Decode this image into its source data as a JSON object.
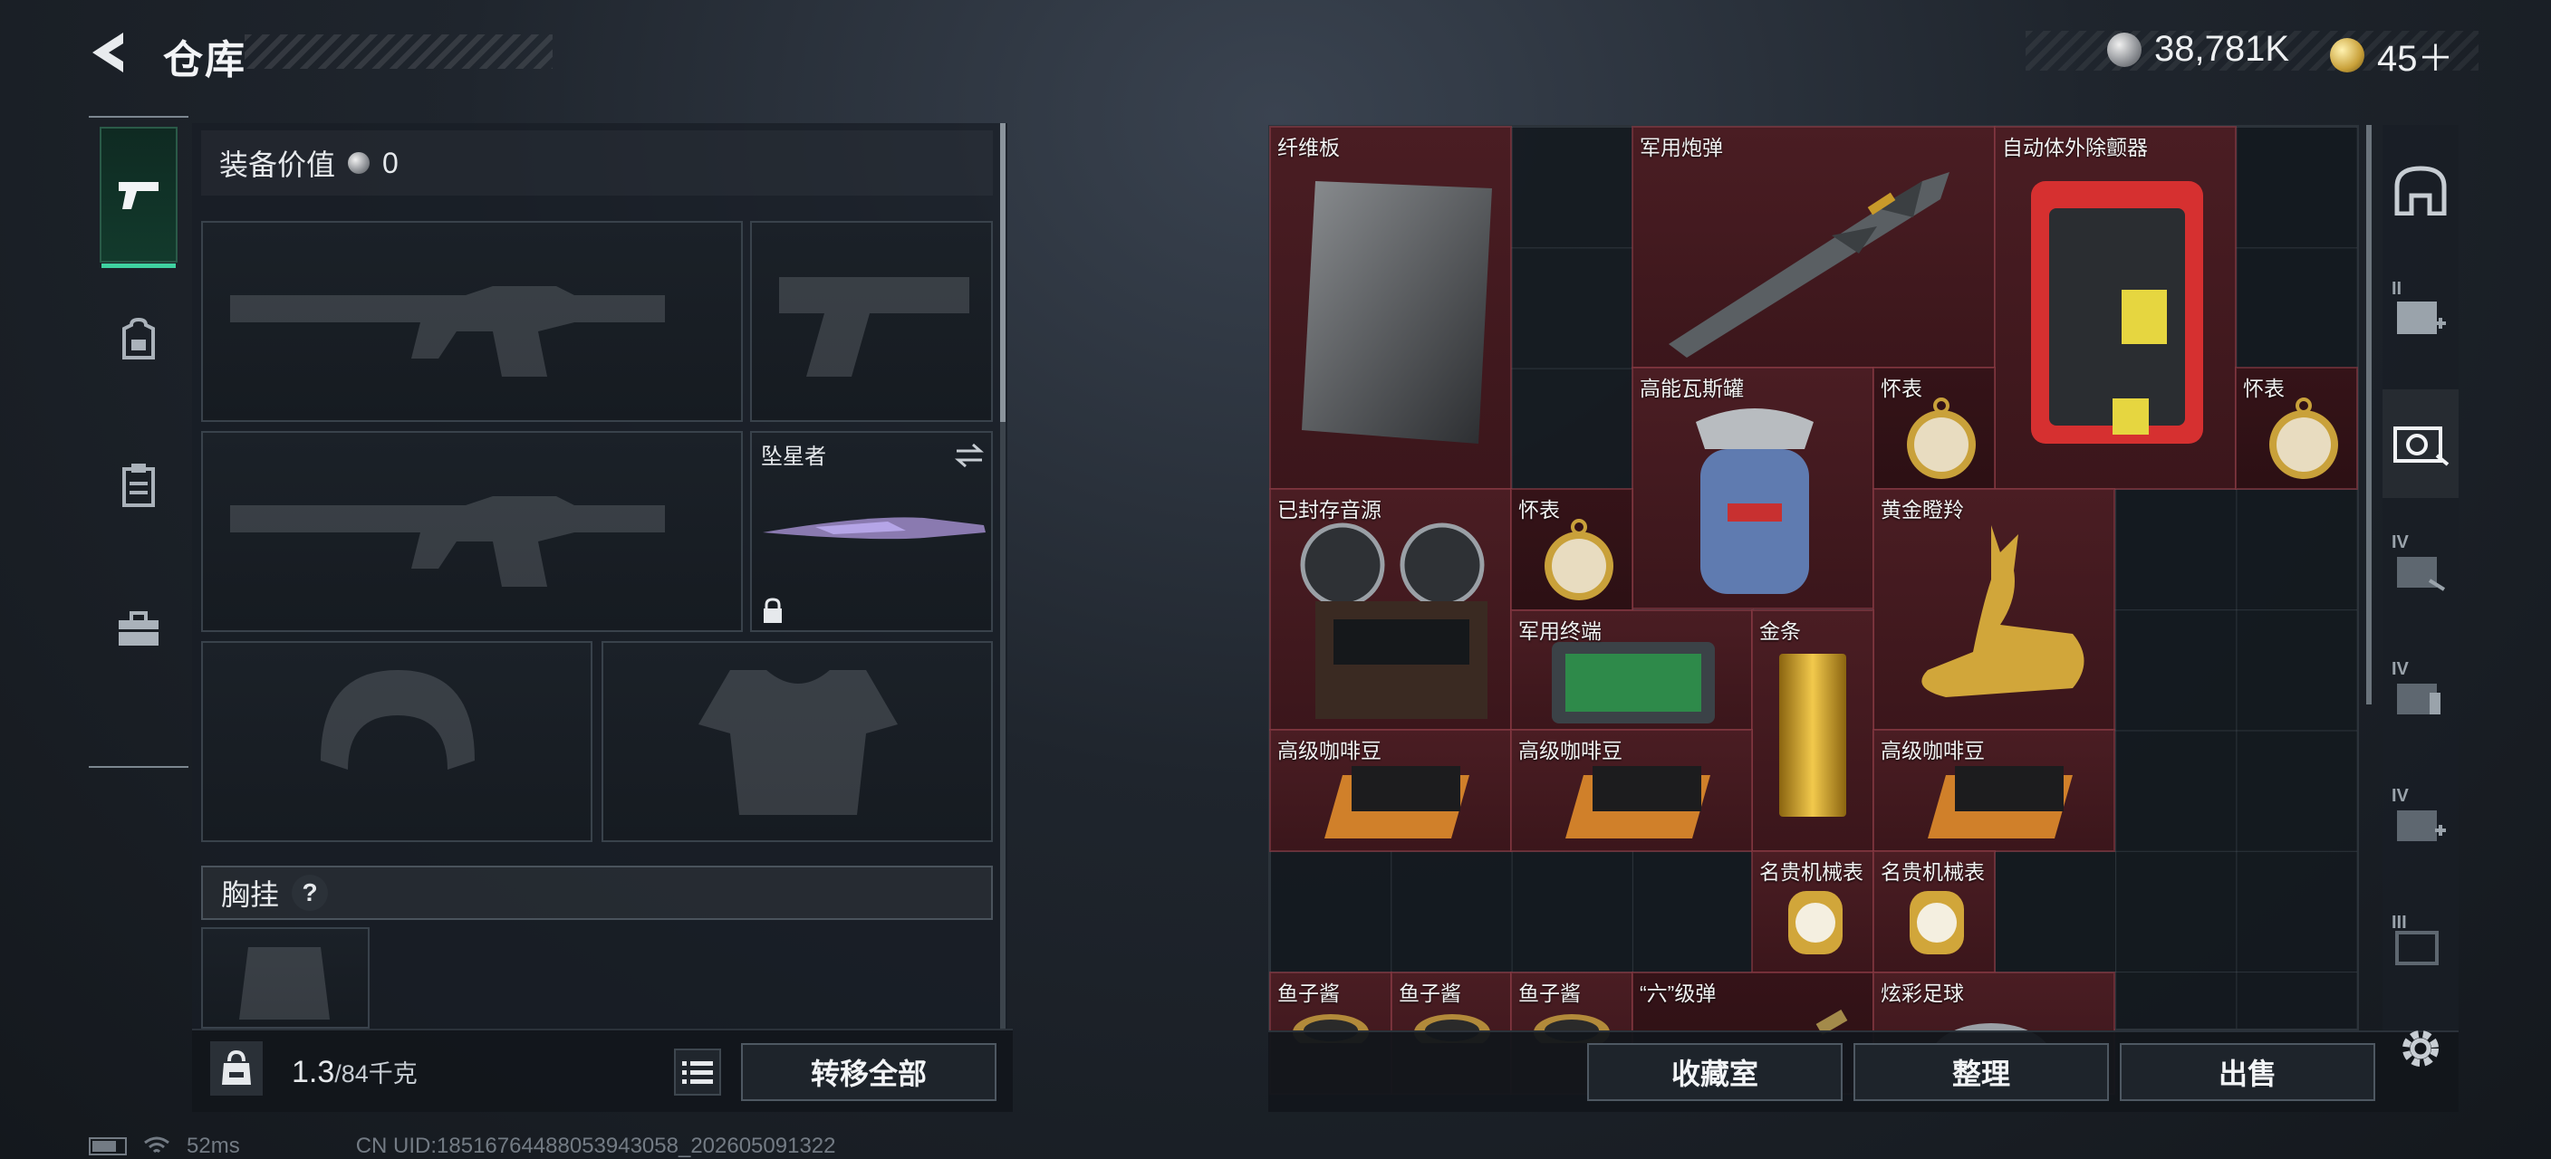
{
  "header": {
    "title": "仓库",
    "currencies": [
      {
        "icon": "silver-coin-icon",
        "value": "38,781K"
      },
      {
        "icon": "gold-coin-icon",
        "value": "45＋"
      }
    ]
  },
  "nav": {
    "items": [
      {
        "icon": "pistol-icon",
        "active": true
      },
      {
        "icon": "backpack-icon",
        "active": false
      },
      {
        "icon": "clipboard-icon",
        "active": false
      },
      {
        "icon": "toolbox-icon",
        "active": false
      }
    ]
  },
  "equipment": {
    "value_label": "装备价值",
    "value": "0",
    "melee_slot_label": "坠星者",
    "chest_rig_label": "胸挂",
    "chest_rig_help": "?"
  },
  "footer_left": {
    "weight_current": "1.3",
    "weight_max": "/84千克",
    "transfer_all": "转移全部"
  },
  "storage": {
    "items": [
      {
        "name": "纤维板",
        "icon": "fiberboard-icon"
      },
      {
        "name": "军用炮弹",
        "icon": "military-shell-icon"
      },
      {
        "name": "自动体外除颤器",
        "icon": "aed-defibrillator-icon"
      },
      {
        "name": "高能瓦斯罐",
        "icon": "gas-canister-icon"
      },
      {
        "name": "怀表",
        "icon": "pocket-watch-icon"
      },
      {
        "name": "怀表",
        "icon": "pocket-watch-icon"
      },
      {
        "name": "已封存音源",
        "icon": "tape-recorder-icon"
      },
      {
        "name": "怀表",
        "icon": "pocket-watch-icon"
      },
      {
        "name": "黄金瞪羚",
        "icon": "gold-gazelle-icon"
      },
      {
        "name": "军用终端",
        "icon": "military-terminal-icon"
      },
      {
        "name": "金条",
        "icon": "gold-bar-icon"
      },
      {
        "name": "高级咖啡豆",
        "icon": "coffee-beans-icon"
      },
      {
        "name": "高级咖啡豆",
        "icon": "coffee-beans-icon"
      },
      {
        "name": "高级咖啡豆",
        "icon": "coffee-beans-icon"
      },
      {
        "name": "名贵机械表",
        "icon": "luxury-watch-icon"
      },
      {
        "name": "名贵机械表",
        "icon": "luxury-watch-icon"
      },
      {
        "name": "鱼子酱",
        "icon": "caviar-tin-icon"
      },
      {
        "name": "鱼子酱",
        "icon": "caviar-tin-icon"
      },
      {
        "name": "鱼子酱",
        "icon": "caviar-tin-icon"
      },
      {
        "name": "“六”级弹",
        "icon": "ammo-icon"
      },
      {
        "name": "炫彩足球",
        "icon": "football-icon"
      }
    ]
  },
  "footer_right": {
    "collection_room": "收藏室",
    "organize": "整理",
    "sell": "出售"
  },
  "right_tabs": {
    "tiers": [
      "",
      "II",
      "",
      "IV",
      "IV",
      "IV",
      "III"
    ]
  },
  "status_bar": {
    "ping": "52ms",
    "uid": "CN UID:185167644880539430​58_202605091322"
  },
  "colors": {
    "accent": "#3fd1a0",
    "item_background": "#4a1d23",
    "panel_background": "#181e25"
  }
}
